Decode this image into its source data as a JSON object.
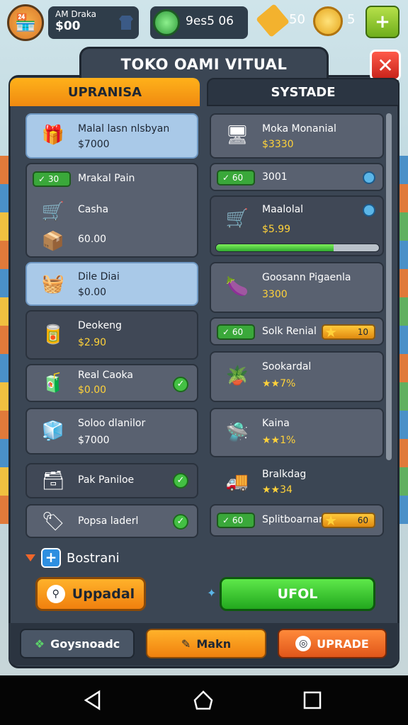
{
  "hud": {
    "player_name": "AM Draka",
    "player_money": "$00",
    "gems": "9es5 06",
    "tickets": "50",
    "coins": "5",
    "add_symbol": "+"
  },
  "window": {
    "title": "TOKO OAMI VITUAL",
    "close": "✕"
  },
  "tabs": {
    "left": "UPRANISA",
    "right": "SYSTADE"
  },
  "left_items": [
    {
      "name": "Malal lasn nlsbyan",
      "price": "$7000"
    },
    {
      "pill": "✓ 30",
      "name": "Mrakal Pain"
    },
    {
      "name": "Casha",
      "price": "60.00"
    },
    {
      "name": "Dile Diai",
      "price": "$0.00"
    },
    {
      "name": "Deokeng",
      "price": "$2.90"
    },
    {
      "name": "Real Caoka",
      "price": "$0.00"
    },
    {
      "name": "Soloo dlanilor",
      "price": "$7000"
    },
    {
      "name": "Pak Paniloe"
    },
    {
      "name": "Popsa laderl"
    }
  ],
  "right_items": [
    {
      "name": "Moka Monanial",
      "price": "$3330"
    },
    {
      "pill": "✓ 60",
      "name": "3001"
    },
    {
      "name": "Maalolal",
      "price": "$5.99"
    },
    {
      "name": "Goosann Pigaenla",
      "price": "3300"
    },
    {
      "pill": "✓ 60",
      "name": "Solk Renial",
      "bar": "10"
    },
    {
      "name": "Sookardal",
      "price": "★★7%"
    },
    {
      "name": "Kaina",
      "price": "★★1%"
    },
    {
      "name": "Bralkdag",
      "price": "★★34"
    },
    {
      "pill": "✓ 60",
      "name": "Splitboarnarl",
      "bar": "60"
    }
  ],
  "progress": {
    "value": 0.72
  },
  "section": {
    "label": "Bostrani"
  },
  "buttons": {
    "upgrade_left": "Uppadal",
    "upgrade_right": "UFOL"
  },
  "footer": {
    "btn1": "Goysnoadc",
    "btn2": "Makn",
    "btn3": "UPRADE"
  },
  "colors": {
    "accent_orange": "#f08a10",
    "accent_green": "#22a81e",
    "panel": "#3b4654",
    "close_red": "#c7231a"
  }
}
